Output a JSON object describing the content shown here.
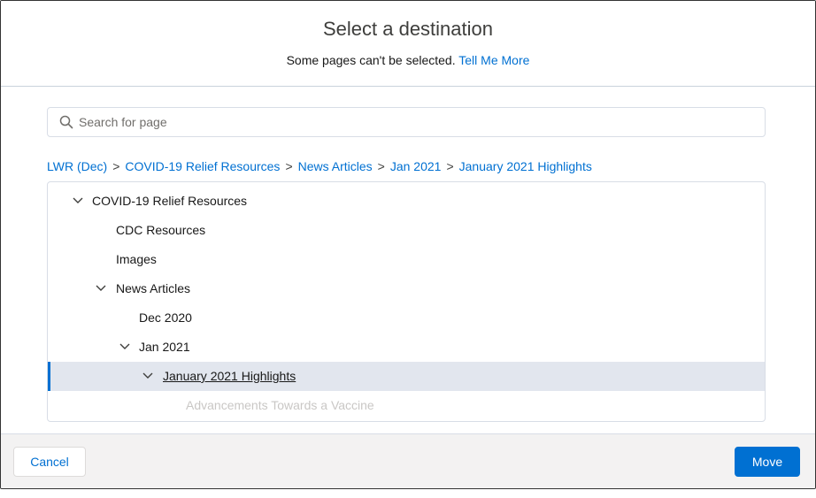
{
  "header": {
    "title": "Select a destination",
    "subtitle": "Some pages can't be selected.",
    "link": "Tell Me More"
  },
  "search": {
    "placeholder": "Search for page",
    "value": ""
  },
  "breadcrumb": {
    "items": [
      "LWR (Dec)",
      "COVID-19 Relief Resources",
      "News Articles",
      "Jan 2021",
      "January 2021 Highlights"
    ],
    "separator": ">"
  },
  "tree": {
    "rows": [
      {
        "label": "COVID-19 Relief Resources",
        "expanded": true
      },
      {
        "label": "CDC Resources"
      },
      {
        "label": "Images"
      },
      {
        "label": "News Articles",
        "expanded": true
      },
      {
        "label": "Dec 2020"
      },
      {
        "label": "Jan 2021",
        "expanded": true
      },
      {
        "label": "January 2021 Highlights",
        "expanded": true,
        "selected": true
      },
      {
        "label": "Advancements Towards a Vaccine",
        "disabled": true
      }
    ]
  },
  "footer": {
    "cancel_label": "Cancel",
    "move_label": "Move"
  },
  "colors": {
    "accent": "#0070d2",
    "selected_row": "#e2e6ee",
    "disabled_text": "#c9c7c5"
  }
}
